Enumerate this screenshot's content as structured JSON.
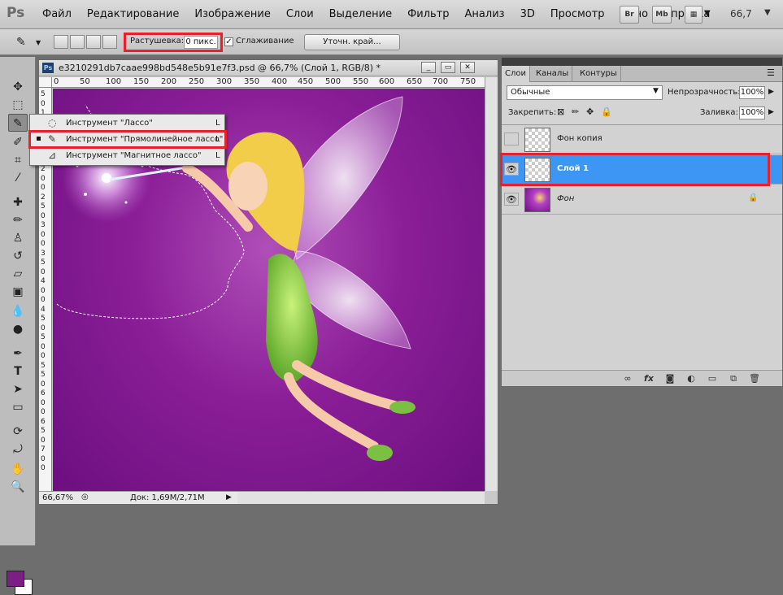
{
  "app": {
    "logo": "Ps"
  },
  "menu": [
    "Файл",
    "Редактирование",
    "Изображение",
    "Слои",
    "Выделение",
    "Фильтр",
    "Анализ",
    "3D",
    "Просмотр",
    "Окно",
    "Справка"
  ],
  "menubar_buttons": {
    "bridge": "Br",
    "mini_bridge": "Mb",
    "zoom": "66,7"
  },
  "options": {
    "feather_label": "Растушевка:",
    "feather_value": "0 пикс.",
    "smooth_checked": "✓",
    "smooth_label": "Сглаживание",
    "refine_label": "Уточн. край..."
  },
  "document": {
    "title": "e3210291db7caae998bd548e5b91e7f3.psd @ 66,7% (Слой 1, RGB/8) *",
    "ruler_h": [
      "0",
      "50",
      "100",
      "150",
      "200",
      "250",
      "300",
      "350",
      "400",
      "450",
      "500",
      "550",
      "600",
      "650",
      "700",
      "750"
    ],
    "ruler_v": [
      "5",
      "0",
      "1",
      "0",
      "0",
      "1",
      "5",
      "0",
      "2",
      "0",
      "0",
      "2",
      "5",
      "0",
      "3",
      "0",
      "0",
      "3",
      "5",
      "0",
      "4",
      "0",
      "0",
      "4",
      "5",
      "0",
      "5",
      "0",
      "0",
      "5",
      "5",
      "0",
      "6",
      "0",
      "0",
      "6",
      "5",
      "0",
      "7",
      "0",
      "0"
    ],
    "zoom_status": "66,67%",
    "doc_size": "Док: 1,69M/2,71M"
  },
  "flyout": {
    "items": [
      {
        "label": "Инструмент \"Лассо\"",
        "key": "L"
      },
      {
        "label": "Инструмент \"Прямолинейное лассо\"",
        "key": "L"
      },
      {
        "label": "Инструмент \"Магнитное лассо\"",
        "key": "L"
      }
    ]
  },
  "layers_panel": {
    "tabs": [
      "Слои",
      "Каналы",
      "Контуры"
    ],
    "blend_mode": "Обычные",
    "opacity_label": "Непрозрачность:",
    "opacity_value": "100%",
    "lock_label": "Закрепить:",
    "fill_label": "Заливка:",
    "fill_value": "100%",
    "layers": [
      {
        "name": "Фон копия",
        "visible": false
      },
      {
        "name": "Слой 1",
        "visible": true,
        "active": true
      },
      {
        "name": "Фон",
        "visible": true,
        "locked": true
      }
    ]
  },
  "colors": {
    "foreground": "#7b1e86",
    "background": "#ffffff",
    "highlight": "#e8202a",
    "selection": "#3e96f4",
    "canvas_bg": "#8a1e97"
  }
}
